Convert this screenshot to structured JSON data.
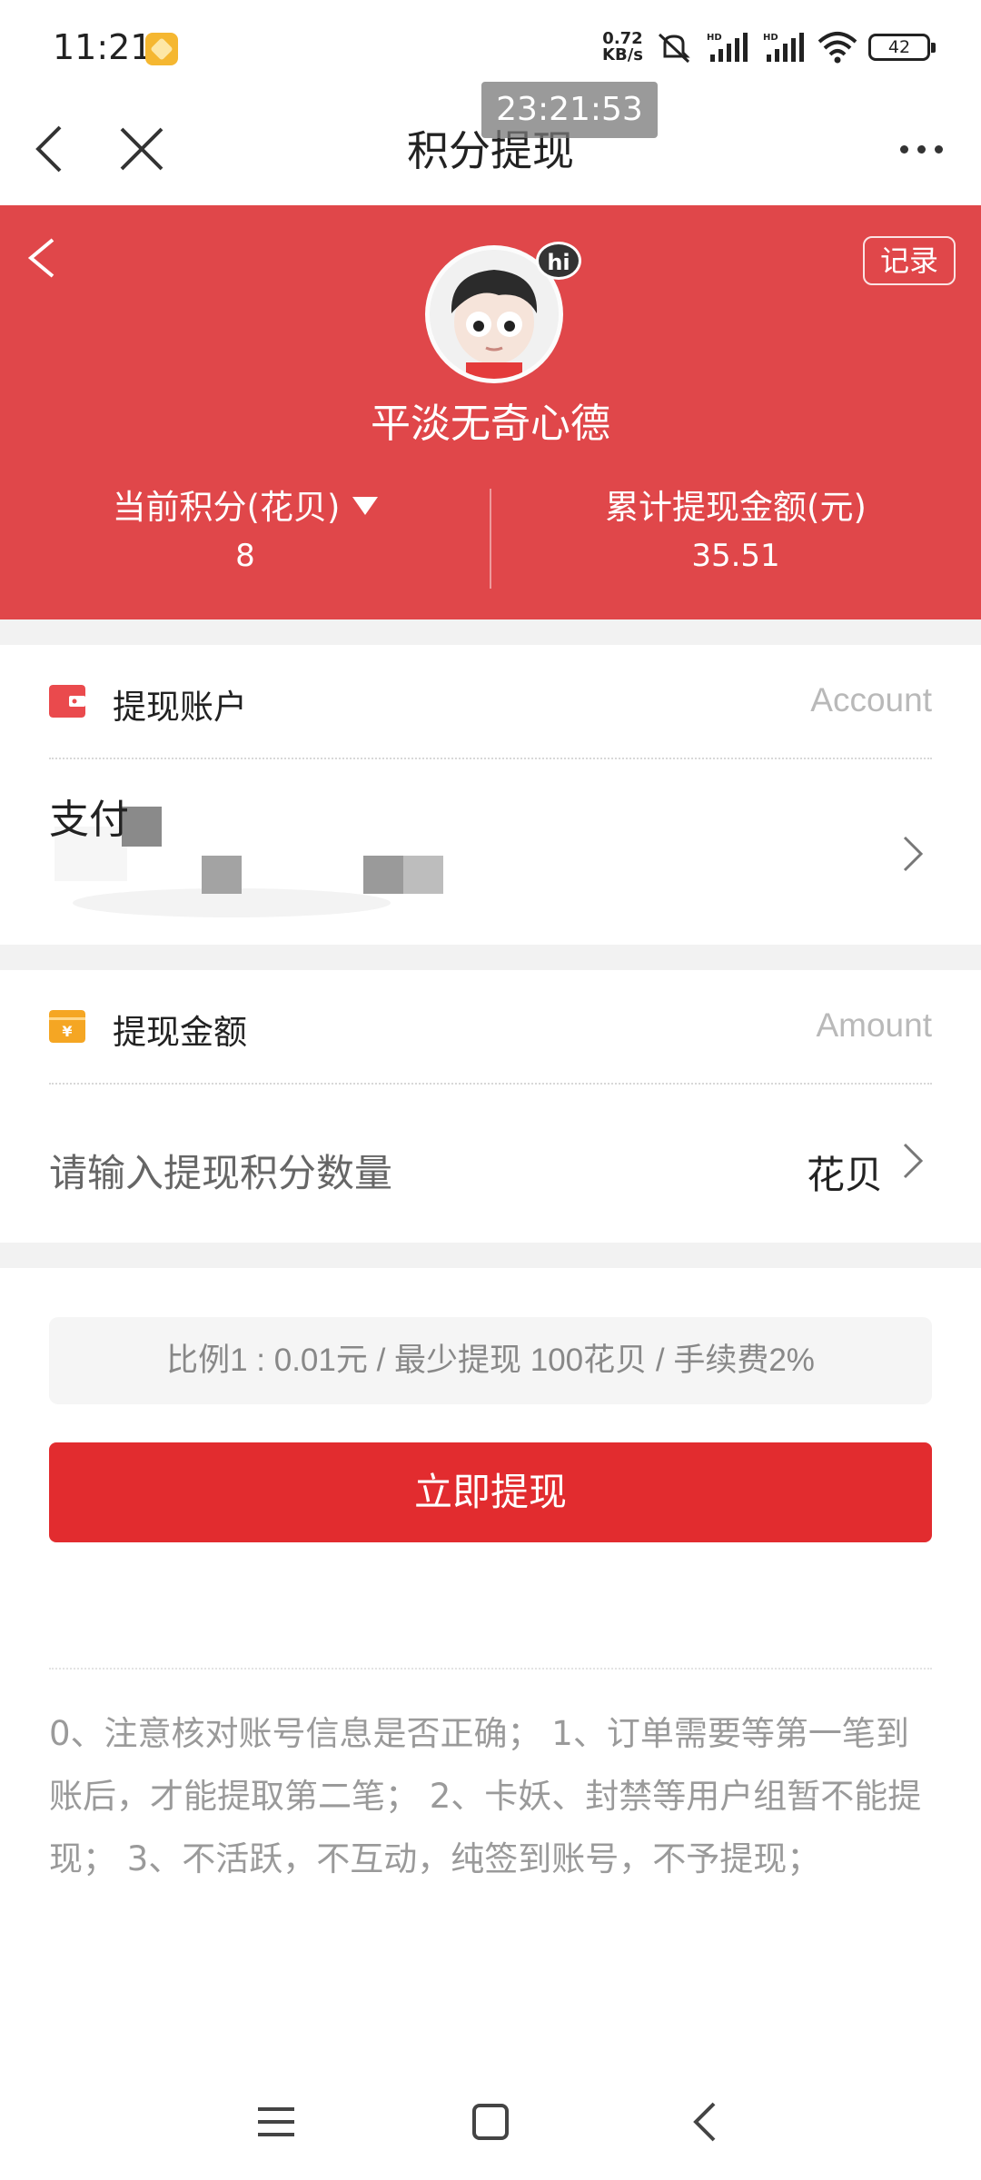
{
  "status_bar": {
    "time": "11:21",
    "net_speed_value": "0.72",
    "net_speed_unit": "KB/s",
    "battery": "42"
  },
  "overlay_time": "23:21:53",
  "title_bar": {
    "title": "积分提现"
  },
  "profile": {
    "avatar_badge": "hi",
    "username": "平淡无奇心德",
    "records_label": "记录"
  },
  "stats": {
    "points_label": "当前积分(花贝)",
    "points_value": "8",
    "total_label": "累计提现金额(元)",
    "total_value": "35.51"
  },
  "account_section": {
    "title": "提现账户",
    "hint": "Account",
    "account_text": "支付"
  },
  "amount_section": {
    "title": "提现金额",
    "hint": "Amount",
    "placeholder": "请输入提现积分数量",
    "unit": "花贝"
  },
  "ratio_info": "比例1 : 0.01元 / 最少提现 100花贝 / 手续费2%",
  "withdraw_button": "立即提现",
  "notes": "0、注意核对账号信息是否正确； 1、订单需要等第一笔到账后，才能提取第二笔； 2、卡妖、封禁等用户组暂不能提现； 3、不活跃，不互动，纯签到账号，不予提现；",
  "colors": {
    "hero_red": "#e0474a",
    "button_red": "#e22c2f",
    "page_gray": "#f2f2f2"
  }
}
